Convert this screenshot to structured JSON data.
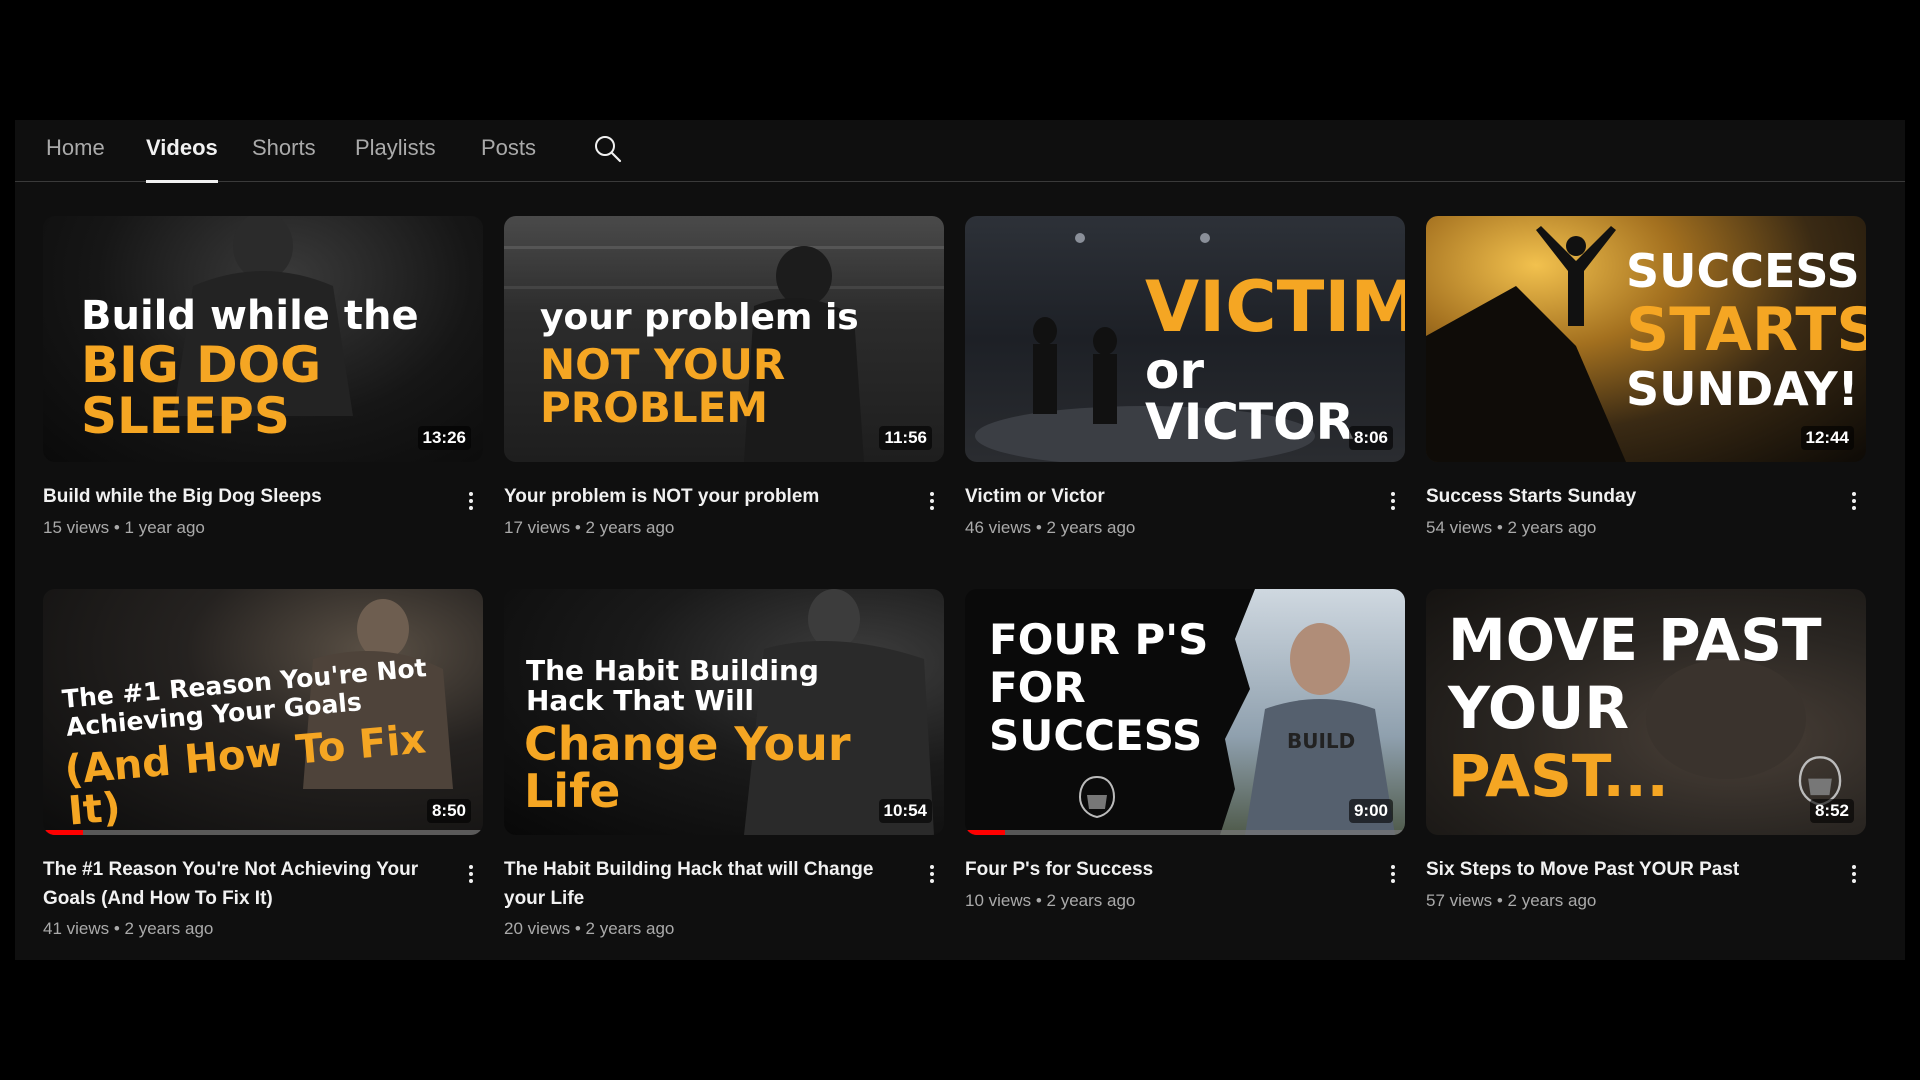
{
  "tabs": [
    {
      "label": "Home",
      "active": false
    },
    {
      "label": "Videos",
      "active": true
    },
    {
      "label": "Shorts",
      "active": false
    },
    {
      "label": "Playlists",
      "active": false
    },
    {
      "label": "Posts",
      "active": false
    }
  ],
  "search_icon": "search-icon",
  "more_icon": "vertical-dots-icon",
  "colors": {
    "accent_orange": "#f5a623",
    "progress_red": "#ff0000",
    "background": "#0f0f0f",
    "meta_gray": "#aaaaaa"
  },
  "videos": [
    {
      "thumb_lines": [
        "Build while the",
        "BIG DOG SLEEPS"
      ],
      "duration": "13:26",
      "title": "Build while the Big Dog Sleeps",
      "meta": "15 views • 1 year ago",
      "progress": 0
    },
    {
      "thumb_lines": [
        "your problem is",
        "NOT YOUR PROBLEM"
      ],
      "duration": "11:56",
      "title": "Your problem is NOT your problem",
      "meta": "17 views • 2 years ago",
      "progress": 0
    },
    {
      "thumb_lines": [
        "VICTIM",
        "or VICTOR"
      ],
      "duration": "8:06",
      "title": "Victim or Victor",
      "meta": "46 views • 2 years ago",
      "progress": 0
    },
    {
      "thumb_lines": [
        "SUCCESS",
        "STARTS",
        "SUNDAY!"
      ],
      "duration": "12:44",
      "title": "Success Starts Sunday",
      "meta": "54 views • 2 years ago",
      "progress": 0
    },
    {
      "thumb_lines": [
        "The #1 Reason You're Not",
        "Achieving Your Goals",
        "(And How To Fix It)"
      ],
      "duration": "8:50",
      "title": "The #1 Reason You're Not Achieving Your Goals (And How To Fix It)",
      "meta": "41 views • 2 years ago",
      "progress": 0.09
    },
    {
      "thumb_lines": [
        "The Habit Building",
        "Hack That Will",
        "Change Your Life"
      ],
      "duration": "10:54",
      "title": "The Habit Building Hack that will Change your Life",
      "meta": "20 views • 2 years ago",
      "progress": 0
    },
    {
      "thumb_lines": [
        "FOUR P'S",
        "FOR",
        "SUCCESS",
        "BUILD"
      ],
      "duration": "9:00",
      "title": "Four P's for Success",
      "meta": "10 views • 2 years ago",
      "progress": 0.09
    },
    {
      "thumb_lines": [
        "MOVE PAST",
        "YOUR",
        "PAST..."
      ],
      "duration": "8:52",
      "title": "Six Steps to Move Past YOUR Past",
      "meta": "57 views • 2 years ago",
      "progress": 0
    }
  ]
}
